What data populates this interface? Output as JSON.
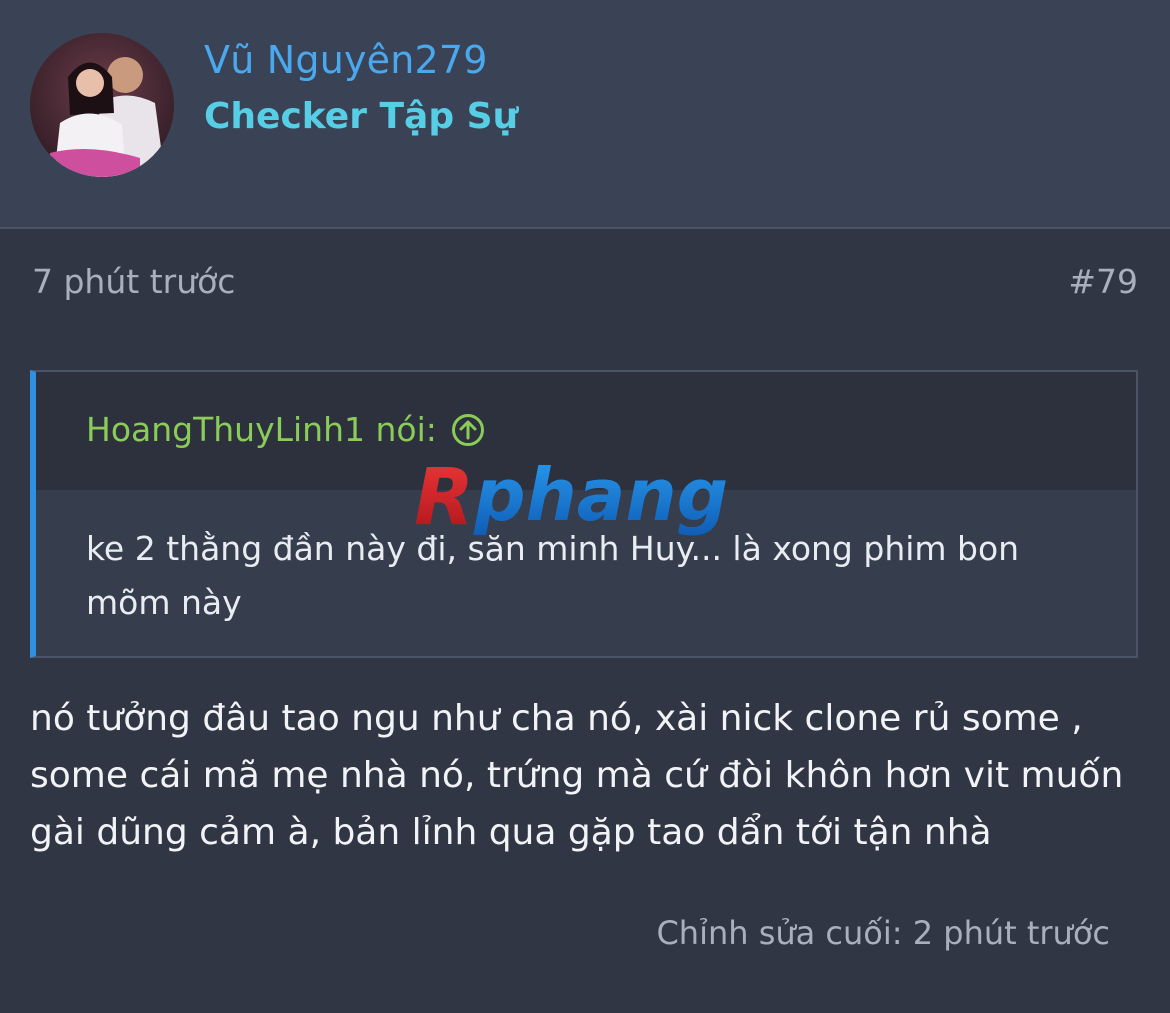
{
  "user": {
    "name": "Vũ Nguyên279",
    "title": "Checker Tập Sự",
    "avatar_icon": "user-avatar-photo"
  },
  "post": {
    "time": "7 phút trước",
    "number": "#79",
    "quote": {
      "author": "HoangThuyLinh1 nói:",
      "author_icon": "arrow-up-circle-icon",
      "text": "ke 2 thằng đần này đi, săn minh Huy... là xong phim bon mõm này"
    },
    "message": "nó tưởng đâu tao ngu như cha nó, xài nick clone rủ some , some cái mã mẹ nhà nó, trứng mà cứ đòi khôn hơn vit muốn gài dũng cảm à, bản lỉnh qua gặp tao dẩn tới tận nhà",
    "edited": "Chỉnh sửa cuối: 2 phút trước"
  },
  "watermark": {
    "first_letter": "R",
    "rest": "phang"
  },
  "colors": {
    "header_bg": "#3a4355",
    "body_bg": "#303644",
    "username": "#4aa8ee",
    "user_title": "#56cfe6",
    "quote_author": "#8bcb57",
    "quote_border": "#2f8fe0",
    "meta_text": "#a9b0bd"
  }
}
